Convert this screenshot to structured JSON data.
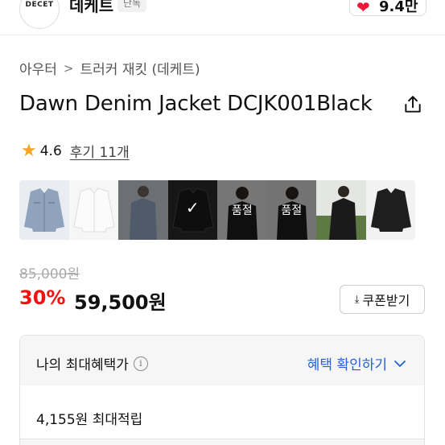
{
  "header": {
    "brand_name": "데케트",
    "brand_tag": "단독",
    "logo_text": "DECET",
    "like_count": "9.4만"
  },
  "breadcrumb": {
    "category": "아우터",
    "subcategory": "트러커 재킷 (데케트)"
  },
  "product": {
    "title": "Dawn Denim Jacket DCJK001Black",
    "rating": "4.6",
    "reviews": "후기 11개"
  },
  "thumbnails": [
    {
      "color": "light-denim",
      "label": "",
      "state": "normal"
    },
    {
      "color": "white",
      "label": "",
      "state": "normal"
    },
    {
      "color": "model-denim",
      "label": "",
      "state": "normal"
    },
    {
      "color": "black",
      "label": "",
      "state": "selected"
    },
    {
      "color": "model-black",
      "label": "품절",
      "state": "soldout"
    },
    {
      "color": "model-black",
      "label": "품절",
      "state": "soldout"
    },
    {
      "color": "model-black-outdoor",
      "label": "",
      "state": "normal"
    },
    {
      "color": "black-flat",
      "label": "",
      "state": "normal"
    }
  ],
  "pricing": {
    "original": "85,000원",
    "discount": "30%",
    "sale": "59,500원",
    "coupon_label": "쿠폰받기"
  },
  "benefit": {
    "title": "나의 최대혜택가",
    "link": "혜택 확인하기",
    "points": "4,155원 최대적립"
  },
  "colors": {
    "accent_red": "#f31110",
    "link_blue": "#2162d4",
    "star": "#f5a623",
    "heart": "#f0183a"
  }
}
